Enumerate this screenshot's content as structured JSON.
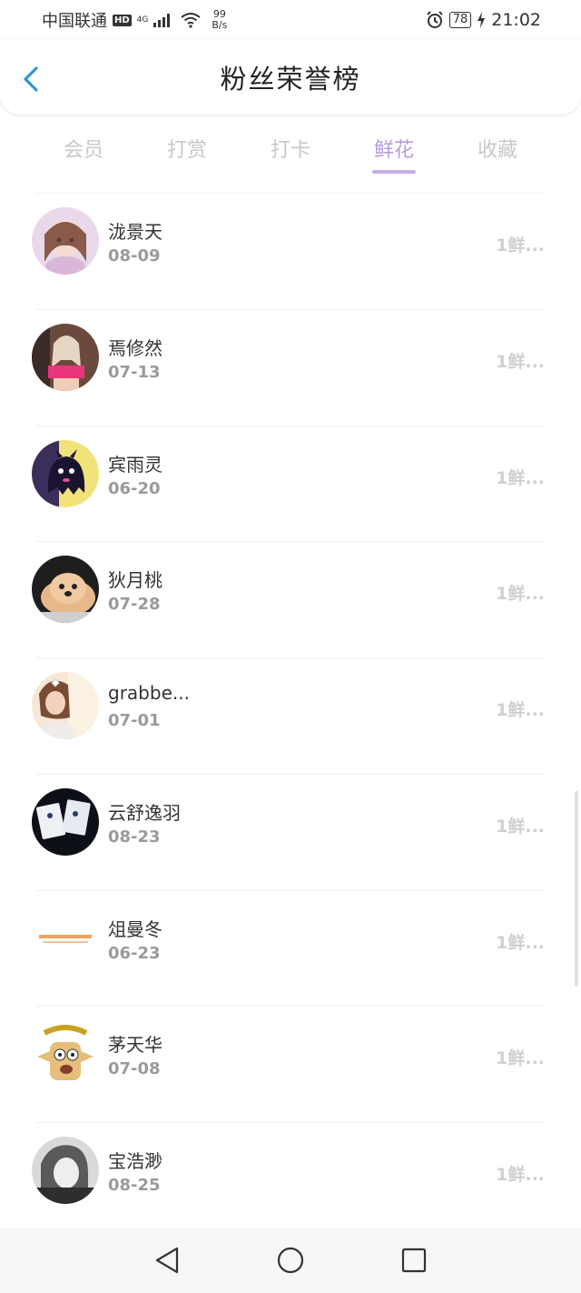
{
  "status": {
    "carrier": "中国联通",
    "hd": "HD",
    "net_type": "4G",
    "speed_value": "99",
    "speed_unit": "B/s",
    "battery": "78",
    "time": "21:02"
  },
  "header": {
    "title": "粉丝荣誉榜"
  },
  "tabs": [
    {
      "label": "会员",
      "active": false
    },
    {
      "label": "打赏",
      "active": false
    },
    {
      "label": "打卡",
      "active": false
    },
    {
      "label": "鲜花",
      "active": true
    },
    {
      "label": "收藏",
      "active": false
    }
  ],
  "fans": [
    {
      "name": "泷景天",
      "date": "08-09",
      "gift": "1鲜...",
      "avatar": "cartoon-girl"
    },
    {
      "name": "焉修然",
      "date": "07-13",
      "gift": "1鲜...",
      "avatar": "photo-woman"
    },
    {
      "name": "宾雨灵",
      "date": "06-20",
      "gift": "1鲜...",
      "avatar": "ghost-cartoon"
    },
    {
      "name": "狄月桃",
      "date": "07-28",
      "gift": "1鲜...",
      "avatar": "puppy"
    },
    {
      "name": "grabbe...",
      "date": "07-01",
      "gift": "1鲜...",
      "avatar": "girl-portrait"
    },
    {
      "name": "云舒逸羽",
      "date": "08-23",
      "gift": "1鲜...",
      "avatar": "cards"
    },
    {
      "name": "俎曼冬",
      "date": "06-23",
      "gift": "1鲜...",
      "avatar": "text-logo"
    },
    {
      "name": "茅天华",
      "date": "07-08",
      "gift": "1鲜...",
      "avatar": "cartoon-face"
    },
    {
      "name": "宝浩渺",
      "date": "08-25",
      "gift": "1鲜...",
      "avatar": "bw-portrait"
    }
  ],
  "colors": {
    "accent": "#b79be0",
    "inactive_tab": "#c8c8c8",
    "back_arrow": "#2f97d6"
  }
}
